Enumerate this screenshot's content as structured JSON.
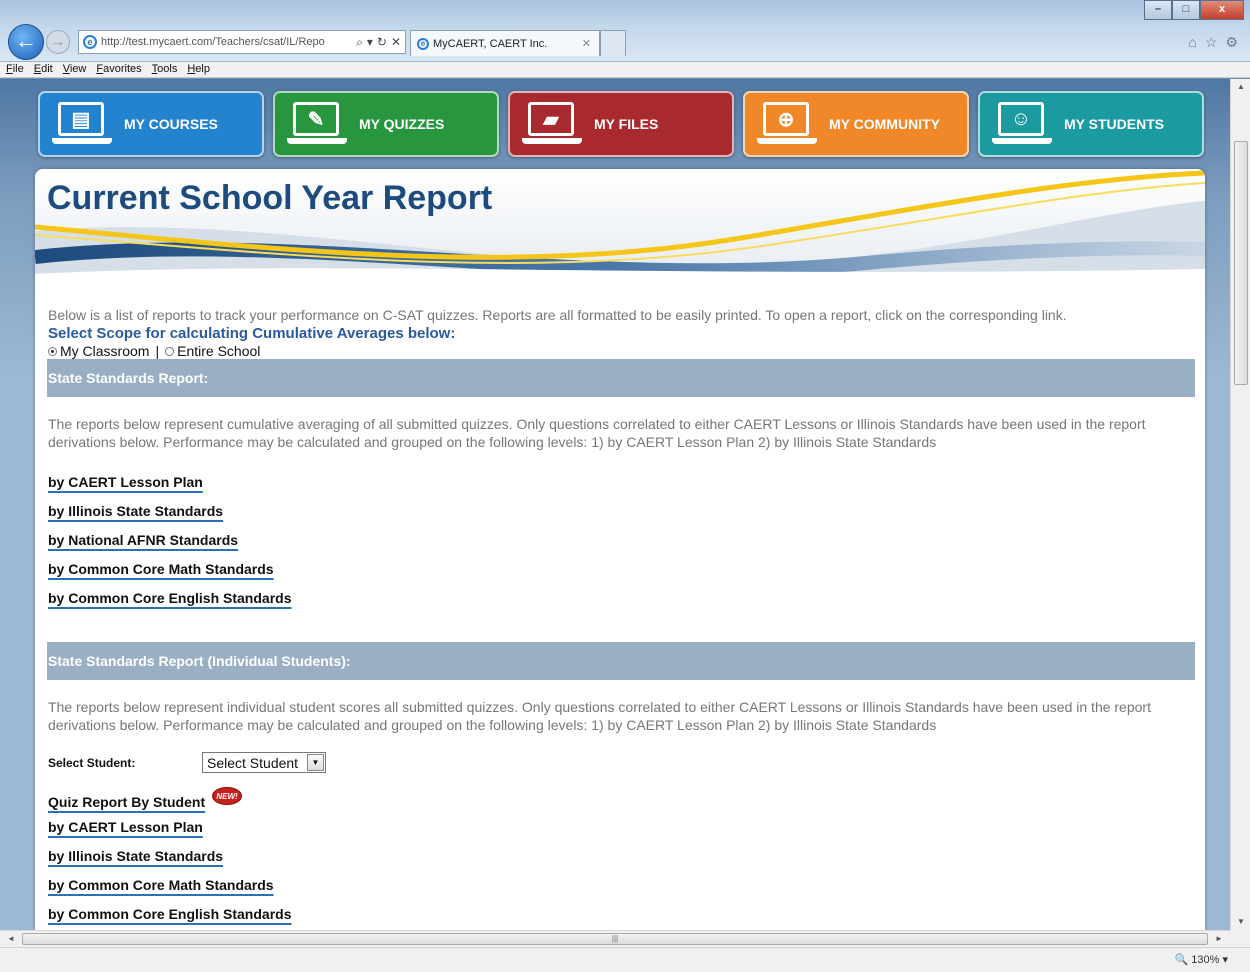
{
  "browser": {
    "url": "http://test.mycaert.com/Teachers/csat/IL/Repo",
    "tab_title": "MyCAERT, CAERT Inc.",
    "menu": [
      "File",
      "Edit",
      "View",
      "Favorites",
      "Tools",
      "Help"
    ],
    "zoom": "130%",
    "window_buttons": [
      "–",
      "□",
      "x"
    ]
  },
  "nav_tiles": [
    {
      "label": "MY COURSES",
      "color": "#2483cf",
      "glyph": "▤"
    },
    {
      "label": "MY QUIZZES",
      "color": "#27963f",
      "glyph": "✎"
    },
    {
      "label": "MY FILES",
      "color": "#a82a2e",
      "glyph": "▰"
    },
    {
      "label": "MY COMMUNITY",
      "color": "#f0882a",
      "glyph": "⊕"
    },
    {
      "label": "MY STUDENTS",
      "color": "#1b9aa0",
      "glyph": "☺"
    }
  ],
  "page": {
    "title": "Current School Year Report",
    "intro": "Below is a list of reports to track your performance on C-SAT quizzes.  Reports are all formatted to be easily printed.  To open a report, click on the corresponding link.",
    "scope_title": "Select Scope for calculating Cumulative Averages below:",
    "scope_options": [
      "My Classroom",
      "Entire School"
    ],
    "scope_separator": "|"
  },
  "section1": {
    "title": "State Standards Report:",
    "description": "The reports below represent cumulative averaging of all submitted quizzes.  Only questions correlated to either CAERT Lessons or Illinois Standards have been used in the report derivations below.  Performance may be calculated and grouped on the following levels: 1) by CAERT Lesson Plan  2) by Illinois State Standards",
    "links": [
      "by CAERT Lesson Plan",
      "by Illinois State Standards",
      "by National AFNR Standards",
      "by Common Core Math Standards",
      "by Common Core English Standards"
    ]
  },
  "section2": {
    "title": "State Standards Report (Individual Students):",
    "description": "The reports below represent individual student scores all submitted quizzes.  Only questions correlated to either CAERT Lessons or Illinois Standards have been used in the report derivations below.  Performance may be calculated and grouped on the following levels: 1) by CAERT Lesson Plan  2) by Illinois State Standards",
    "select_label": "Select Student:",
    "select_value": "Select Student",
    "quiz_report_link": "Quiz Report By Student",
    "new_badge": "NEW!",
    "links": [
      "by CAERT Lesson Plan",
      "by Illinois State Standards",
      "by Common Core Math Standards",
      "by Common Core English Standards"
    ]
  }
}
